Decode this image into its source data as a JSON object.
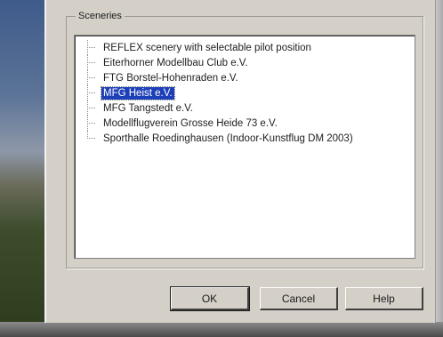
{
  "dialog": {
    "group_title": "Sceneries",
    "items": [
      {
        "label": "REFLEX scenery with selectable pilot position",
        "selected": false
      },
      {
        "label": "Eiterhorner Modellbau Club e.V.",
        "selected": false
      },
      {
        "label": "FTG Borstel-Hohenraden e.V.",
        "selected": false
      },
      {
        "label": "MFG Heist e.V.",
        "selected": true
      },
      {
        "label": "MFG Tangstedt e.V.",
        "selected": false
      },
      {
        "label": "Modellflugverein Grosse Heide 73 e.V.",
        "selected": false
      },
      {
        "label": "Sporthalle Roedinghausen (Indoor-Kunstflug DM 2003)",
        "selected": false
      }
    ],
    "buttons": {
      "ok": "OK",
      "cancel": "Cancel",
      "help": "Help"
    }
  },
  "colors": {
    "dialog_face": "#d4d0c8",
    "selection": "#1d3fb8"
  }
}
